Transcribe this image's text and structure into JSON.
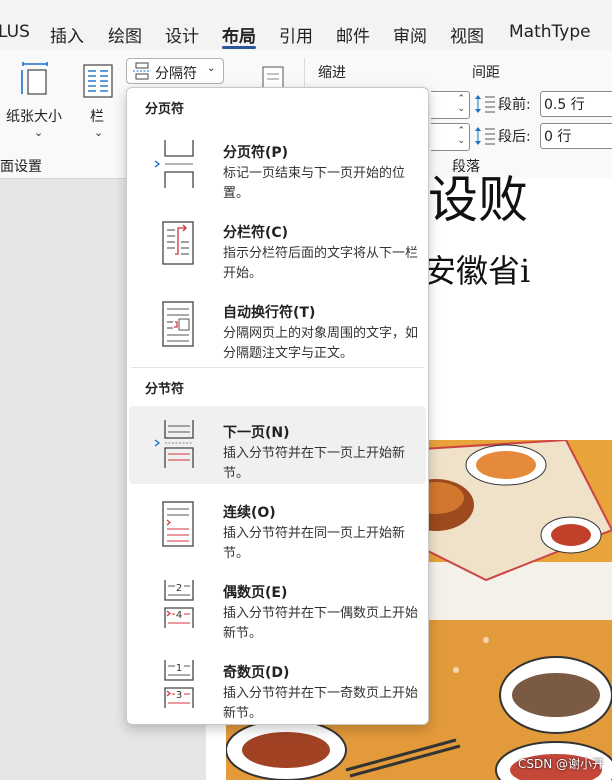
{
  "ribbon_tabs": [
    "LUS",
    "插入",
    "绘图",
    "设计",
    "布局",
    "引用",
    "邮件",
    "审阅",
    "视图",
    "MathType"
  ],
  "active_tab": "布局",
  "ribbon": {
    "paper_size_label": "纸张大小",
    "columns_label": "栏",
    "breaks_button_label": "分隔符",
    "page_setup_group": "面设置",
    "indent_label": "缩进",
    "spacing_label": "间距",
    "before_label": "段前:",
    "before_value": "0.5 行",
    "after_label": "段后:",
    "after_value": "0 行",
    "paragraph_group": "段落"
  },
  "document": {
    "title_fragment": "设败",
    "subtitle_fragment": "基于安徽省i",
    "watermark": "CSDN @谢小开"
  },
  "menu": {
    "page_breaks_header": "分页符",
    "section_breaks_header": "分节符",
    "items": [
      {
        "icon": "page-break-icon",
        "title": "分页符(P)",
        "desc": "标记一页结束与下一页开始的位置。"
      },
      {
        "icon": "column-break-icon",
        "title": "分栏符(C)",
        "desc": "指示分栏符后面的文字将从下一栏开始。"
      },
      {
        "icon": "text-wrapping-break-icon",
        "title": "自动换行符(T)",
        "desc": "分隔网页上的对象周围的文字，如分隔题注文字与正文。"
      },
      {
        "icon": "next-page-section-icon",
        "title": "下一页(N)",
        "desc": "插入分节符并在下一页上开始新节。"
      },
      {
        "icon": "continuous-section-icon",
        "title": "连续(O)",
        "desc": "插入分节符并在同一页上开始新节。"
      },
      {
        "icon": "even-page-section-icon",
        "title": "偶数页(E)",
        "desc": "插入分节符并在下一偶数页上开始新节。",
        "glyphs": [
          "2",
          "4"
        ]
      },
      {
        "icon": "odd-page-section-icon",
        "title": "奇数页(D)",
        "desc": "插入分节符并在下一奇数页上开始新节。",
        "glyphs": [
          "1",
          "3"
        ]
      }
    ]
  }
}
